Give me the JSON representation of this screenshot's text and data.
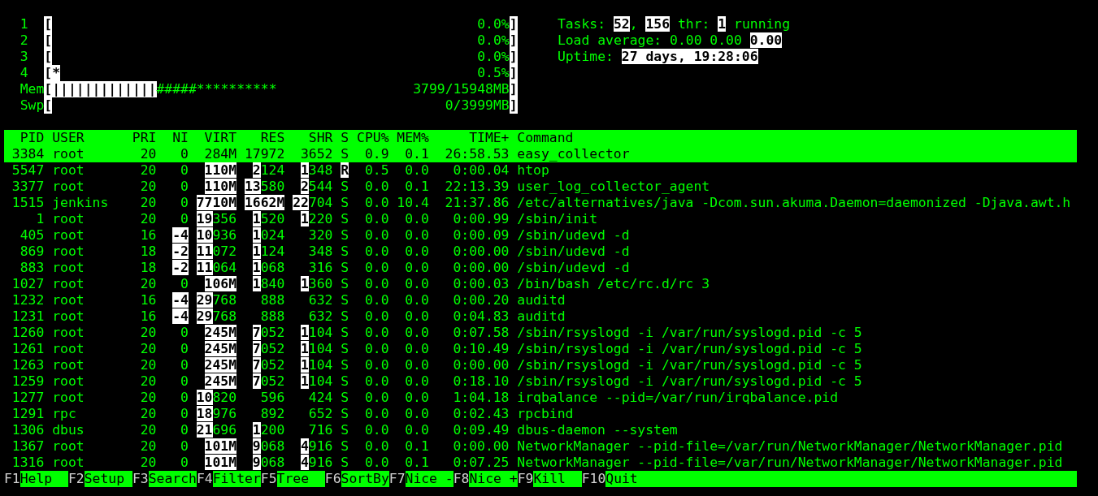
{
  "meters": {
    "brackets": [
      "[",
      "]"
    ],
    "items": [
      {
        "label": "1",
        "reading": "0.0%"
      },
      {
        "label": "2",
        "reading": "0.0%"
      },
      {
        "label": "3",
        "reading": "0.0%"
      },
      {
        "label": "4",
        "segments": [
          {
            "kind": "used",
            "text": "*"
          }
        ],
        "reading": "0.5%"
      },
      {
        "label": "Mem",
        "segments": [
          {
            "kind": "used",
            "text": "|||||||||||||"
          },
          {
            "kind": "buffers",
            "text": "#####"
          },
          {
            "kind": "cache",
            "text": "**********"
          }
        ],
        "reading": "3799/15948MB"
      },
      {
        "label": "Swp",
        "reading": "0/3999MB"
      }
    ]
  },
  "summary": [
    "Tasks: **52**, **156** thr: **1** running",
    "Load average: 0.00 0.00 **0.00**",
    "Uptime: **27 days, 19:28:06**"
  ],
  "table": {
    "columns": [
      "PID",
      "USER",
      "PRI",
      "NI",
      "VIRT",
      "RES",
      "SHR",
      "S",
      "CPU%",
      "MEM%",
      "TIME+",
      "Command"
    ],
    "rows": [
      {
        "selected": true,
        "cells": [
          "3384",
          "root",
          "20",
          "0",
          "284M",
          "17972",
          "3652",
          "S",
          "0.9",
          "0.1",
          "26:58.53",
          "easy_collector"
        ]
      },
      {
        "selected": false,
        "cells": [
          "5547",
          "root",
          "20",
          "0",
          "**110M**",
          "**2**124",
          "**1**348",
          "**R**",
          "0.5",
          "0.0",
          "0:00.04",
          "htop"
        ]
      },
      {
        "selected": false,
        "cells": [
          "3377",
          "root",
          "20",
          "0",
          "**110M**",
          "**13**580",
          "**2**544",
          "S",
          "0.0",
          "0.1",
          "22:13.39",
          "user_log_collector_agent"
        ]
      },
      {
        "selected": false,
        "cells": [
          "1515",
          "jenkins",
          "20",
          "0",
          "**7710M**",
          "**1662M**",
          "**22**704",
          "S",
          "0.0",
          "10.4",
          "21:37.86",
          "/etc/alternatives/java -Dcom.sun.akuma.Daemon=daemonized -Djava.awt.h"
        ]
      },
      {
        "selected": false,
        "cells": [
          "1",
          "root",
          "20",
          "0",
          "**19**356",
          "**1**520",
          "**1**220",
          "S",
          "0.0",
          "0.0",
          "0:00.99",
          "/sbin/init"
        ]
      },
      {
        "selected": false,
        "cells": [
          "405",
          "root",
          "16",
          "**-4**",
          "**10**936",
          "**1**024",
          "320",
          "S",
          "0.0",
          "0.0",
          "0:00.09",
          "/sbin/udevd -d"
        ]
      },
      {
        "selected": false,
        "cells": [
          "869",
          "root",
          "18",
          "**-2**",
          "**11**072",
          "**1**124",
          "348",
          "S",
          "0.0",
          "0.0",
          "0:00.00",
          "/sbin/udevd -d"
        ]
      },
      {
        "selected": false,
        "cells": [
          "883",
          "root",
          "18",
          "**-2**",
          "**11**064",
          "**1**068",
          "316",
          "S",
          "0.0",
          "0.0",
          "0:00.00",
          "/sbin/udevd -d"
        ]
      },
      {
        "selected": false,
        "cells": [
          "1027",
          "root",
          "20",
          "0",
          "**106M**",
          "**1**840",
          "**1**360",
          "S",
          "0.0",
          "0.0",
          "0:00.03",
          "/bin/bash /etc/rc.d/rc 3"
        ]
      },
      {
        "selected": false,
        "cells": [
          "1232",
          "root",
          "16",
          "**-4**",
          "**29**768",
          "888",
          "632",
          "S",
          "0.0",
          "0.0",
          "0:00.20",
          "auditd"
        ]
      },
      {
        "selected": false,
        "cells": [
          "1231",
          "root",
          "16",
          "**-4**",
          "**29**768",
          "888",
          "632",
          "S",
          "0.0",
          "0.0",
          "0:04.83",
          "auditd"
        ]
      },
      {
        "selected": false,
        "cells": [
          "1260",
          "root",
          "20",
          "0",
          "**245M**",
          "**7**052",
          "**1**104",
          "S",
          "0.0",
          "0.0",
          "0:07.58",
          "/sbin/rsyslogd -i /var/run/syslogd.pid -c 5"
        ]
      },
      {
        "selected": false,
        "cells": [
          "1261",
          "root",
          "20",
          "0",
          "**245M**",
          "**7**052",
          "**1**104",
          "S",
          "0.0",
          "0.0",
          "0:10.49",
          "/sbin/rsyslogd -i /var/run/syslogd.pid -c 5"
        ]
      },
      {
        "selected": false,
        "cells": [
          "1263",
          "root",
          "20",
          "0",
          "**245M**",
          "**7**052",
          "**1**104",
          "S",
          "0.0",
          "0.0",
          "0:00.00",
          "/sbin/rsyslogd -i /var/run/syslogd.pid -c 5"
        ]
      },
      {
        "selected": false,
        "cells": [
          "1259",
          "root",
          "20",
          "0",
          "**245M**",
          "**7**052",
          "**1**104",
          "S",
          "0.0",
          "0.0",
          "0:18.10",
          "/sbin/rsyslogd -i /var/run/syslogd.pid -c 5"
        ]
      },
      {
        "selected": false,
        "cells": [
          "1277",
          "root",
          "20",
          "0",
          "**10**820",
          "596",
          "424",
          "S",
          "0.0",
          "0.0",
          "1:04.18",
          "irqbalance --pid=/var/run/irqbalance.pid"
        ]
      },
      {
        "selected": false,
        "cells": [
          "1291",
          "rpc",
          "20",
          "0",
          "**18**976",
          "892",
          "652",
          "S",
          "0.0",
          "0.0",
          "0:02.43",
          "rpcbind"
        ]
      },
      {
        "selected": false,
        "cells": [
          "1306",
          "dbus",
          "20",
          "0",
          "**21**696",
          "**1**200",
          "716",
          "S",
          "0.0",
          "0.0",
          "0:09.49",
          "dbus-daemon --system"
        ]
      },
      {
        "selected": false,
        "cells": [
          "1367",
          "root",
          "20",
          "0",
          "**101M**",
          "**9**068",
          "**4**916",
          "S",
          "0.0",
          "0.1",
          "0:00.00",
          "NetworkManager --pid-file=/var/run/NetworkManager/NetworkManager.pid"
        ]
      },
      {
        "selected": false,
        "cells": [
          "1316",
          "root",
          "20",
          "0",
          "**101M**",
          "**9**068",
          "**4**916",
          "S",
          "0.0",
          "0.1",
          "0:07.25",
          "NetworkManager --pid-file=/var/run/NetworkManager/NetworkManager.pid"
        ]
      }
    ]
  },
  "function_keys": [
    {
      "key": "F1",
      "label": "Help"
    },
    {
      "key": "F2",
      "label": "Setup"
    },
    {
      "key": "F3",
      "label": "Search"
    },
    {
      "key": "F4",
      "label": "Filter"
    },
    {
      "key": "F5",
      "label": "Tree"
    },
    {
      "key": "F6",
      "label": "SortBy"
    },
    {
      "key": "F7",
      "label": "Nice -"
    },
    {
      "key": "F8",
      "label": "Nice +"
    },
    {
      "key": "F9",
      "label": "Kill"
    },
    {
      "key": "F10",
      "label": "Quit"
    }
  ]
}
